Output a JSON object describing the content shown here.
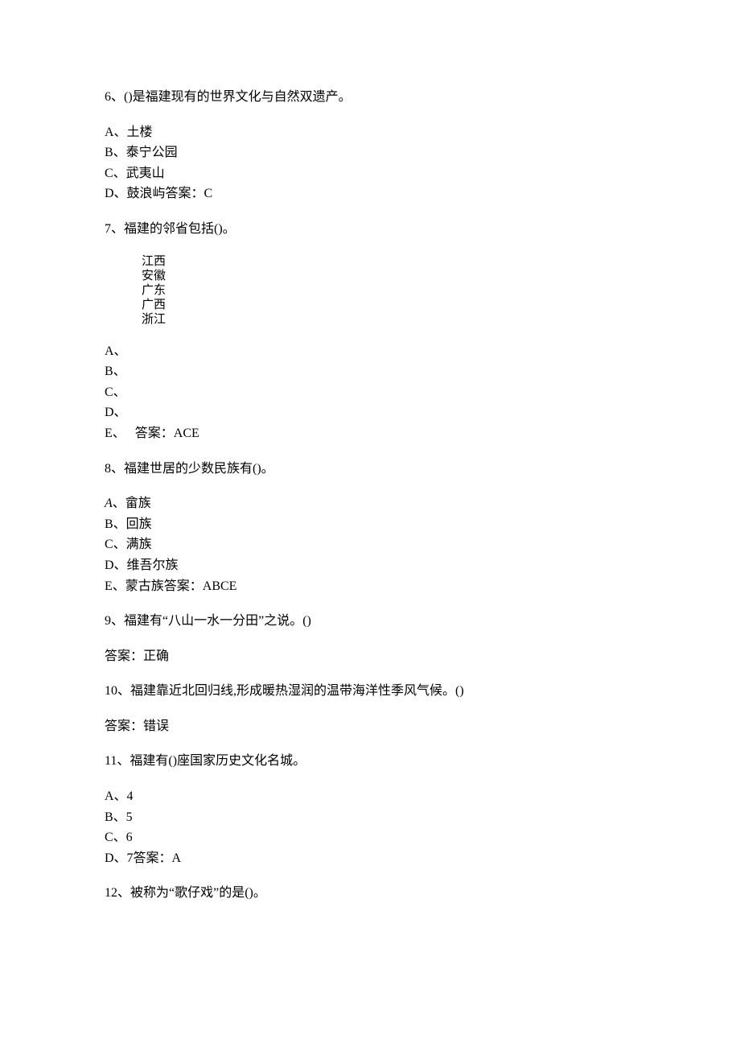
{
  "q6": {
    "stem": "6、()是福建现有的世界文化与自然双遗产。",
    "A": "A、土楼",
    "B": "B、泰宁公园",
    "C": "C、武夷山",
    "D": "D、鼓浪屿答案：C"
  },
  "q7": {
    "stem": "7、福建的邻省包括()。",
    "inset1": "江西",
    "inset2": "安徽",
    "inset3": "广东",
    "inset4": "广西",
    "inset5": "浙江",
    "A": "A、",
    "B": "B、",
    "C": "C、",
    "D": "D、",
    "E": "E、　 答案：ACE"
  },
  "q8": {
    "stem": "8、福建世居的少数民族有()。",
    "A_label": "A",
    "A_rest": "、畲族",
    "B": "B、回族",
    "C": "C、满族",
    "D": "D、维吾尔族",
    "E": "E、蒙古族答案：ABCE"
  },
  "q9": {
    "stem": "9、福建有“八山一水一分田”之说。()",
    "ans": "答案：正确"
  },
  "q10": {
    "stem": "10、福建靠近北回归线,形成暖热湿润的温带海洋性季风气候。()",
    "ans": "答案：错误"
  },
  "q11": {
    "stem": "11、福建有()座国家历史文化名城。",
    "A": "A、4",
    "B": "B、5",
    "C": "C、6",
    "D": "D、7答案：A"
  },
  "q12": {
    "stem": "12、被称为“歌仔戏”的是()。"
  }
}
